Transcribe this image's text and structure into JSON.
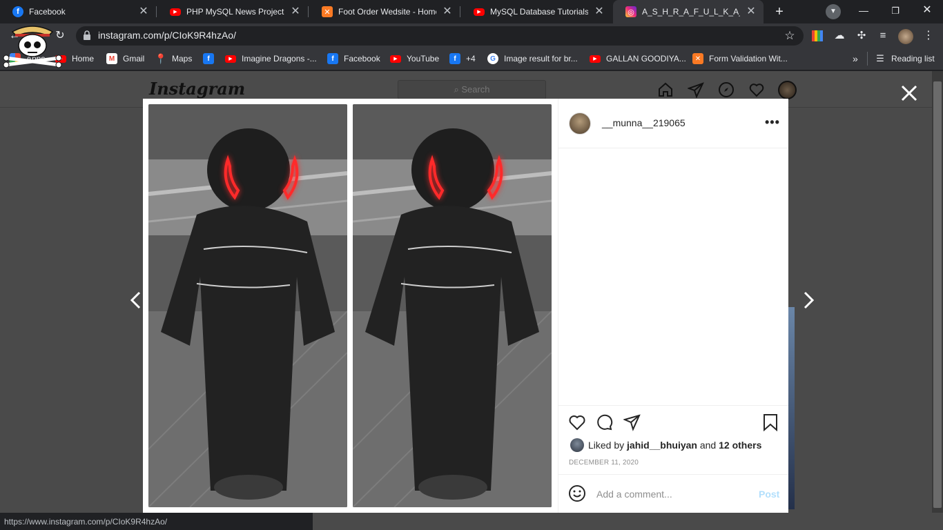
{
  "tabs": [
    {
      "title": "Facebook",
      "icon": "facebook-icon"
    },
    {
      "title": "PHP MySQL News Project Int",
      "icon": "youtube-icon"
    },
    {
      "title": "Foot Order Wedsite - Home P",
      "icon": "xampp-icon"
    },
    {
      "title": "MySQL Database Tutorials in",
      "icon": "youtube-icon"
    },
    {
      "title": "A_S_H_R_A_F_U_L_K_A_R_I_M",
      "icon": "instagram-icon"
    }
  ],
  "address": {
    "url": "instagram.com/p/CIoK9R4hzAo/"
  },
  "bookmarks": [
    {
      "label": "Apps",
      "icon": "apps-grid-icon"
    },
    {
      "label": "Home",
      "icon": "youtube-icon"
    },
    {
      "label": "Gmail",
      "icon": "gmail-icon"
    },
    {
      "label": "Maps",
      "icon": "maps-icon"
    },
    {
      "label": "",
      "icon": "facebook-icon"
    },
    {
      "label": "Imagine Dragons -...",
      "icon": "youtube-icon"
    },
    {
      "label": "Facebook",
      "icon": "facebook-icon"
    },
    {
      "label": "YouTube",
      "icon": "youtube-icon"
    },
    {
      "label": "+4",
      "icon": "facebook-icon"
    },
    {
      "label": "Image result for br...",
      "icon": "google-icon"
    },
    {
      "label": "GALLAN GOODIYA...",
      "icon": "youtube-icon"
    },
    {
      "label": "Form Validation Wit...",
      "icon": "xampp-icon"
    }
  ],
  "reading_list": "Reading list",
  "more_bookmarks": "»",
  "instagram": {
    "logo": "Instagram",
    "search_placeholder": "Search"
  },
  "post": {
    "username": "__munna__219065",
    "more": "•••",
    "liked_prefix": "Liked by ",
    "liked_user": "jahid__bhuiyan",
    "liked_mid": " and ",
    "liked_others": "12 others",
    "date": "DECEMBER 11, 2020",
    "comment_placeholder": "Add a comment...",
    "post_label": "Post"
  },
  "status_url": "https://www.instagram.com/p/CIoK9R4hzAo/",
  "colors": {
    "accent": "#0095f6",
    "post_disabled": "#b2dffc",
    "neon_horns": "#ff2a2a"
  }
}
